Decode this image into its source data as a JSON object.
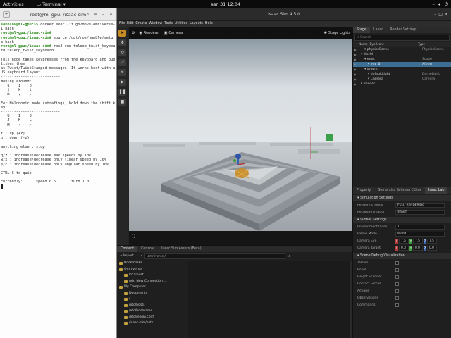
{
  "topbar": {
    "activities": "Activities",
    "app_name": "Terminal",
    "clock": "авг 31  12:04",
    "tray_icons": [
      "network-icon",
      "volume-icon",
      "power-icon"
    ]
  },
  "terminal": {
    "title": "root@ml-gpu: /isaac-sim",
    "lines": [
      {
        "prompt": "sokolov@ml-gpu:~$",
        "text": " docker exec -it go2move-omniverse-1 bash"
      },
      {
        "prompt": "root@ml-gpu:/isaac-sim#",
        "text": ""
      },
      {
        "prompt": "root@ml-gpu:/isaac-sim#",
        "text": " source /opt/ros/humble/setup.bash"
      },
      {
        "prompt": "root@ml-gpu:/isaac-sim#",
        "text": " ros2 run teleop_twist_keyboard teleop_twist_keyboard"
      },
      {
        "prompt": "",
        "text": ""
      },
      {
        "prompt": "",
        "text": "This node takes keypresses from the keyboard and publishes them"
      },
      {
        "prompt": "",
        "text": "as Twist/TwistStamped messages. It works best with a US keyboard layout."
      },
      {
        "prompt": "",
        "text": "---------------------------"
      },
      {
        "prompt": "",
        "text": "Moving around:"
      },
      {
        "prompt": "",
        "text": "   u    i    o"
      },
      {
        "prompt": "",
        "text": "   j    k    l"
      },
      {
        "prompt": "",
        "text": "   m    ,    ."
      },
      {
        "prompt": "",
        "text": ""
      },
      {
        "prompt": "",
        "text": "For Holonomic mode (strafing), hold down the shift key:"
      },
      {
        "prompt": "",
        "text": "---------------------------"
      },
      {
        "prompt": "",
        "text": "   U    I    O"
      },
      {
        "prompt": "",
        "text": "   J    K    L"
      },
      {
        "prompt": "",
        "text": "   M    <    >"
      },
      {
        "prompt": "",
        "text": ""
      },
      {
        "prompt": "",
        "text": "t : up (+z)"
      },
      {
        "prompt": "",
        "text": "b : down (-z)"
      },
      {
        "prompt": "",
        "text": ""
      },
      {
        "prompt": "",
        "text": "anything else : stop"
      },
      {
        "prompt": "",
        "text": ""
      },
      {
        "prompt": "",
        "text": "q/z : increase/decrease max speeds by 10%"
      },
      {
        "prompt": "",
        "text": "w/x : increase/decrease only linear speed by 10%"
      },
      {
        "prompt": "",
        "text": "e/c : increase/decrease only angular speed by 10%"
      },
      {
        "prompt": "",
        "text": ""
      },
      {
        "prompt": "",
        "text": "CTRL-C to quit"
      },
      {
        "prompt": "",
        "text": ""
      },
      {
        "prompt": "",
        "text": "currently:\tspeed 0.5\tturn 1.0 "
      }
    ]
  },
  "isaac": {
    "title": "Isaac Sim 4.5.0",
    "menu": [
      "File",
      "Edit",
      "Create",
      "Window",
      "Tools",
      "Utilities",
      "Layouts",
      "Help"
    ],
    "viewport": {
      "renderer_label": "Renderer",
      "camera_label": "Camera",
      "stage_lights_label": "Stage Lights"
    },
    "stage": {
      "tabs": [
        "Stage",
        "Layer",
        "Render Settings"
      ],
      "search_placeholder": "Search",
      "col_name": "Name (Eye Icon)",
      "col_type": "Type",
      "rows": [
        {
          "name": "physicsScene",
          "type": "PhysicsScene",
          "indent": 2,
          "sel": false
        },
        {
          "name": "World",
          "type": "",
          "indent": 1,
          "sel": false
        },
        {
          "name": "envs",
          "type": "Scope",
          "indent": 2,
          "sel": false
        },
        {
          "name": "env_0",
          "type": "Xform",
          "indent": 3,
          "sel": true
        },
        {
          "name": "ground",
          "type": "",
          "indent": 2,
          "sel": false
        },
        {
          "name": "defaultLight",
          "type": "DomeLight",
          "indent": 3,
          "sel": false
        },
        {
          "name": "Camera",
          "type": "Camera",
          "indent": 3,
          "sel": false
        },
        {
          "name": "Render",
          "type": "",
          "indent": 1,
          "sel": false
        }
      ]
    },
    "properties": {
      "tabs": [
        "Property",
        "Semantics Schema Editor",
        "Isaac Lab"
      ],
      "sections": [
        {
          "title": "Simulation Settings",
          "rows": [
            {
              "label": "Rendering Mode",
              "value": "FULL_RENDERING"
            },
            {
              "label": "Record Animation",
              "value": "START"
            }
          ]
        },
        {
          "title": "Viewer Settings",
          "rows": [
            {
              "label": "Environment Index",
              "value": "1"
            },
            {
              "label": "Follow Mode",
              "value": "World"
            },
            {
              "label": "Camera Eye",
              "x": "7.5",
              "y": "7.5",
              "z": "7.5"
            },
            {
              "label": "Camera Target",
              "x": "0.0",
              "y": "0.0",
              "z": "0.0"
            }
          ]
        },
        {
          "title": "Scene Debug Visualization",
          "rows": [
            {
              "label": "Terrain",
              "check": true
            },
            {
              "label": "Robot",
              "check": true
            },
            {
              "label": "Height Scanner",
              "check": true
            },
            {
              "label": "Contact Forces",
              "check": true
            },
            {
              "label": "Actions",
              "check": true
            },
            {
              "label": "Observations",
              "check": true
            },
            {
              "label": "Commands",
              "check": true
            }
          ]
        }
      ]
    },
    "content": {
      "tabs": [
        "Content",
        "Console",
        "Isaac Sim Assets (Beta)"
      ],
      "import_label": "Import",
      "path": "omniverse://",
      "tree": [
        "Bookmarks",
        "Omniverse",
        "localhost",
        "Add New Connection ...",
        "My Computer",
        "Documents",
        "/",
        "/etc/hosts",
        "/etc/hostname",
        "/etc/resolv.conf",
        "/isaac-sim/exts"
      ]
    },
    "colors": {
      "accent": "#c88c24",
      "selection": "#3d6f95",
      "x": "#b33a3a",
      "y": "#3a9a3a",
      "z": "#3a62b3"
    }
  }
}
